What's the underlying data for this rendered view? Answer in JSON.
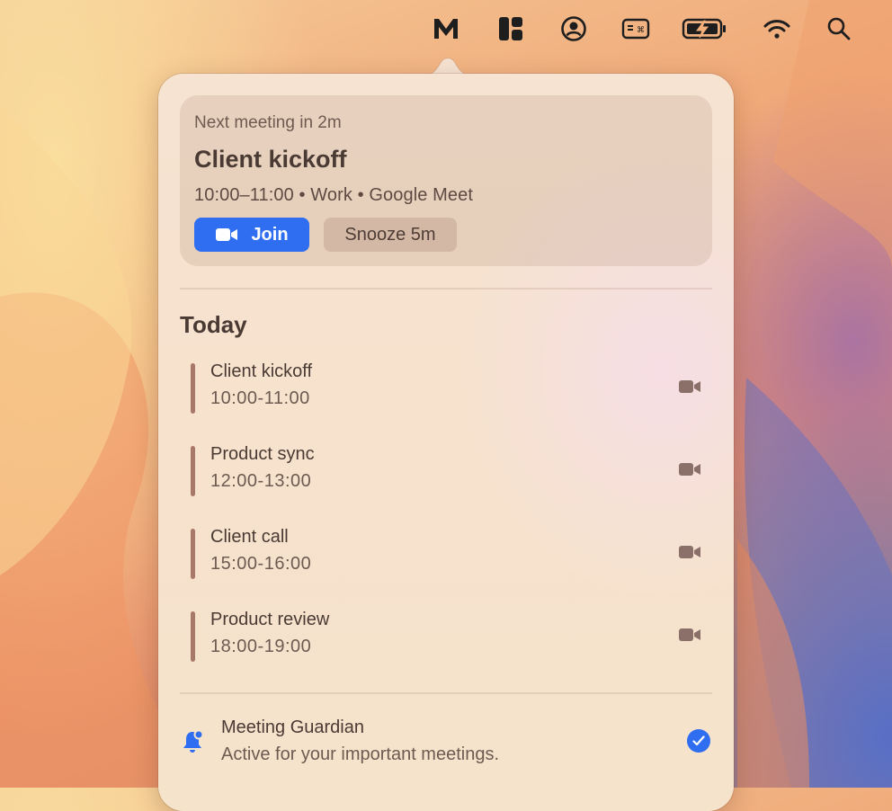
{
  "menubar": {
    "icons": [
      "meet-app-m-icon",
      "layout-grid-icon",
      "user-circle-icon",
      "keyboard-shortcut-icon",
      "battery-charging-icon",
      "wifi-icon",
      "search-icon"
    ]
  },
  "next_meeting": {
    "eyebrow": "Next meeting in 2m",
    "title": "Client kickoff",
    "meta": "10:00–11:00 • Work • Google Meet",
    "join_label": "Join",
    "snooze_label": "Snooze 5m"
  },
  "today": {
    "title": "Today",
    "events": [
      {
        "title": "Client kickoff",
        "time": "10:00-11:00",
        "icon": "video-camera-icon"
      },
      {
        "title": "Product sync",
        "time": "12:00-13:00",
        "icon": "video-camera-icon"
      },
      {
        "title": "Client call",
        "time": "15:00-16:00",
        "icon": "video-camera-icon"
      },
      {
        "title": "Product review",
        "time": "18:00-19:00",
        "icon": "video-camera-icon"
      }
    ]
  },
  "guardian": {
    "title": "Meeting Guardian",
    "subtitle": "Active for your important meetings.",
    "enabled": true
  },
  "colors": {
    "accent": "#2f6ef0",
    "event_bar": "#a87868",
    "text_primary": "#4a3a34"
  }
}
